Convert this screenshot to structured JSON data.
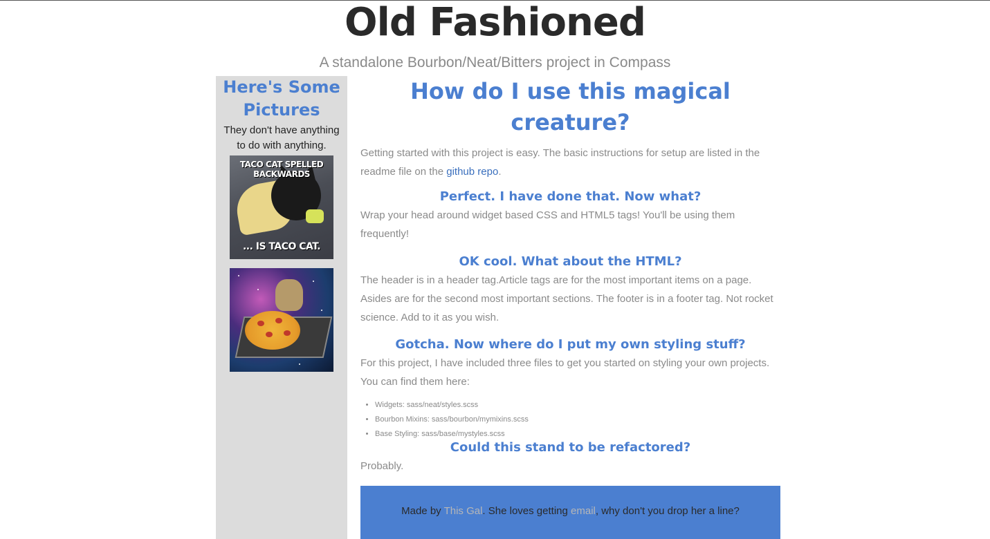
{
  "header": {
    "title": "Old Fashioned",
    "subtitle": "A standalone Bourbon/Neat/Bitters project in Compass"
  },
  "sidebar": {
    "title": "Here's Some Pictures",
    "subtitle": "They don't have anything to do with anything.",
    "images": [
      {
        "caption_top": "TACO CAT SPELLED BACKWARDS",
        "caption_bottom": "... IS TACO CAT."
      },
      {
        "caption_top": "",
        "caption_bottom": ""
      }
    ]
  },
  "main": {
    "heading": "How do I use this magical creature?",
    "intro_text": "Getting started with this project is easy. The basic instructions for setup are listed in the readme file on the ",
    "intro_link": "github repo",
    "intro_end": ".",
    "sections": [
      {
        "heading": "Perfect. I have done that. Now what?",
        "text": "Wrap your head around widget based CSS and HTML5 tags! You'll be using them frequently!"
      },
      {
        "heading": "OK cool. What about the HTML?",
        "text": "The header is in a header tag.Article tags are for the most important items on a page. Asides are for the second most important sections. The footer is in a footer tag. Not rocket science. Add to it as you wish."
      },
      {
        "heading": "Gotcha. Now where do I put my own styling stuff?",
        "text": "For this project, I have included three files to get you started on styling your own projects. You can find them here:"
      }
    ],
    "files": [
      "Widgets: sass/neat/styles.scss",
      "Bourbon Mixins: sass/bourbon/mymixins.scss",
      "Base Styling: sass/base/mystyles.scss"
    ],
    "last_heading": "Could this stand to be refactored?",
    "last_text": "Probably."
  },
  "footer": {
    "prefix": "Made by ",
    "author_link": "This Gal",
    "middle": ". She loves getting ",
    "email_link": "email",
    "suffix": ", why don't you drop her a line?"
  }
}
